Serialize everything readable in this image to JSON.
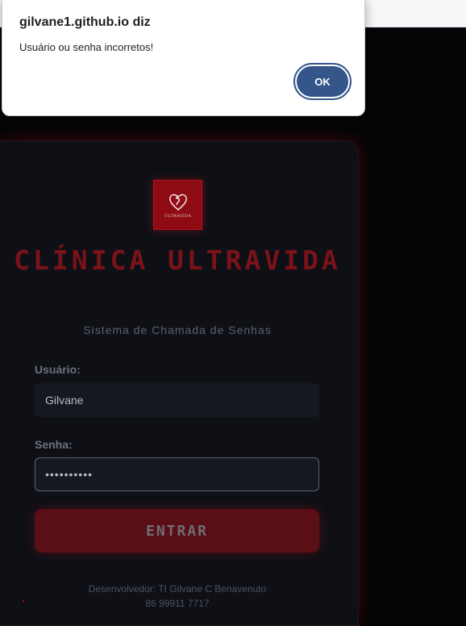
{
  "alert": {
    "title": "gilvane1.github.io diz",
    "message": "Usuário ou senha incorretos!",
    "ok_label": "OK"
  },
  "logo": {
    "caption": "ULTRAVIDA",
    "icon": "ultravida-heart-logo-icon"
  },
  "login": {
    "title": "CLÍNICA ULTRAVIDA",
    "subtitle": "Sistema de Chamada de Senhas",
    "username_label": "Usuário:",
    "username_value": "Gilvane",
    "password_label": "Senha:",
    "password_value": "••••••••••",
    "submit_label": "ENTRAR",
    "developer_line": "Desenvolvedor: TI Gilvane C Benavenuto",
    "phone_line": "86 99911 7717"
  },
  "colors": {
    "accent_red": "#8e0b13",
    "button_red": "#5a0e16",
    "dialog_button": "#34568b",
    "card_background": "#0e1016"
  }
}
